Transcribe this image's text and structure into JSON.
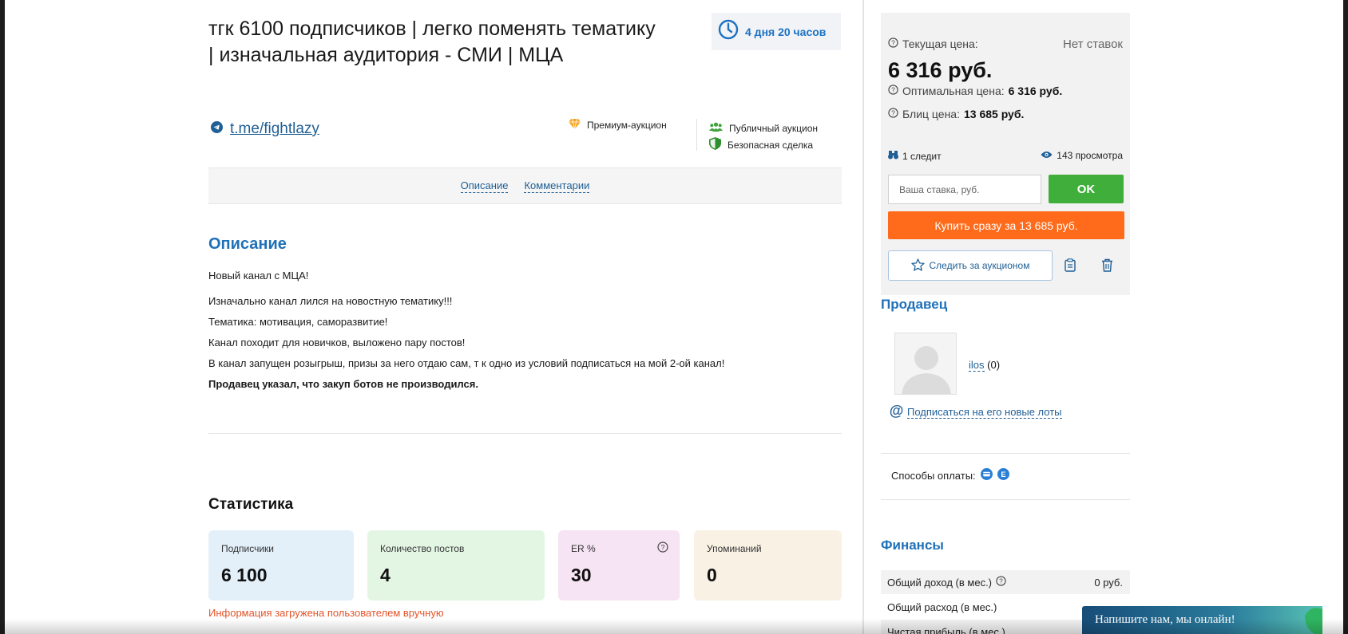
{
  "lot": {
    "title": "тгк 6100 подписчиков | легко поменять тематику | изначальная аудитория - СМИ | МЦА",
    "time_left": "4 дня 20 часов",
    "channel_link": "t.me/fightlazy",
    "badge_premium": "Премиум-аукцион",
    "badge_public": "Публичный аукцион",
    "badge_safe": "Безопасная сделка"
  },
  "tabs": [
    {
      "label": "Описание"
    },
    {
      "label": "Комментарии"
    }
  ],
  "description": {
    "heading": "Описание",
    "paragraphs": [
      "Новый канал с МЦА!",
      "Изначально канал лился на новостную тематику!!!",
      "Тематика: мотивация, саморазвитие!",
      "Канал походит для новичков, выложено пару постов!",
      "В канал запущен розыгрыш, призы за него отдаю сам, т к одно из условий подписаться на мой 2-ой канал!"
    ],
    "bots_note": "Продавец указал, что закуп ботов не производился."
  },
  "stats": {
    "heading": "Статистика",
    "cards": [
      {
        "label": "Подписчики",
        "value": "6 100",
        "color": "#e3f0fa"
      },
      {
        "label": "Количество постов",
        "value": "4",
        "color": "#e3f6e4"
      },
      {
        "label": "ER %",
        "value": "30",
        "color": "#f6e3f3"
      },
      {
        "label": "Упоминаний",
        "value": "0",
        "color": "#f8f1e4"
      }
    ],
    "note": "Информация загружена пользователем вручную"
  },
  "pricing": {
    "current_label": "Текущая цена:",
    "no_bids": "Нет ставок",
    "current_price": "6 316 руб.",
    "optimal_label": "Оптимальная цена:",
    "optimal_value": "6 316 руб.",
    "blitz_label": "Блиц цена:",
    "blitz_value": "13 685 руб.",
    "followers": "1 следит",
    "views": "143 просмотра",
    "bid_placeholder": "Ваша ставка, руб.",
    "ok_label": "OK",
    "buy_label": "Купить сразу за 13 685 руб.",
    "watch_label": "Следить за аукционом"
  },
  "seller": {
    "heading": "Продавец",
    "name": "ilos",
    "rating": "(0)",
    "subscribe_label": "Подписаться на его новые лоты",
    "payment_label": "Способы оплаты:"
  },
  "finance": {
    "heading": "Финансы",
    "rows": [
      {
        "label": "Общий доход (в мес.)",
        "value": "0 руб."
      },
      {
        "label": "Общий расход (в мес.)",
        "value": ""
      },
      {
        "label": "Чистая прибыль (в мес.)",
        "value": ""
      }
    ]
  },
  "chat": {
    "label": "Напишите нам, мы онлайн!"
  },
  "colors": {
    "link": "#1f5f95",
    "heading_blue": "#1f70b8",
    "ok_green": "#3fae3a",
    "buy_orange": "#ff6b1a",
    "note_red": "#e5542a"
  }
}
